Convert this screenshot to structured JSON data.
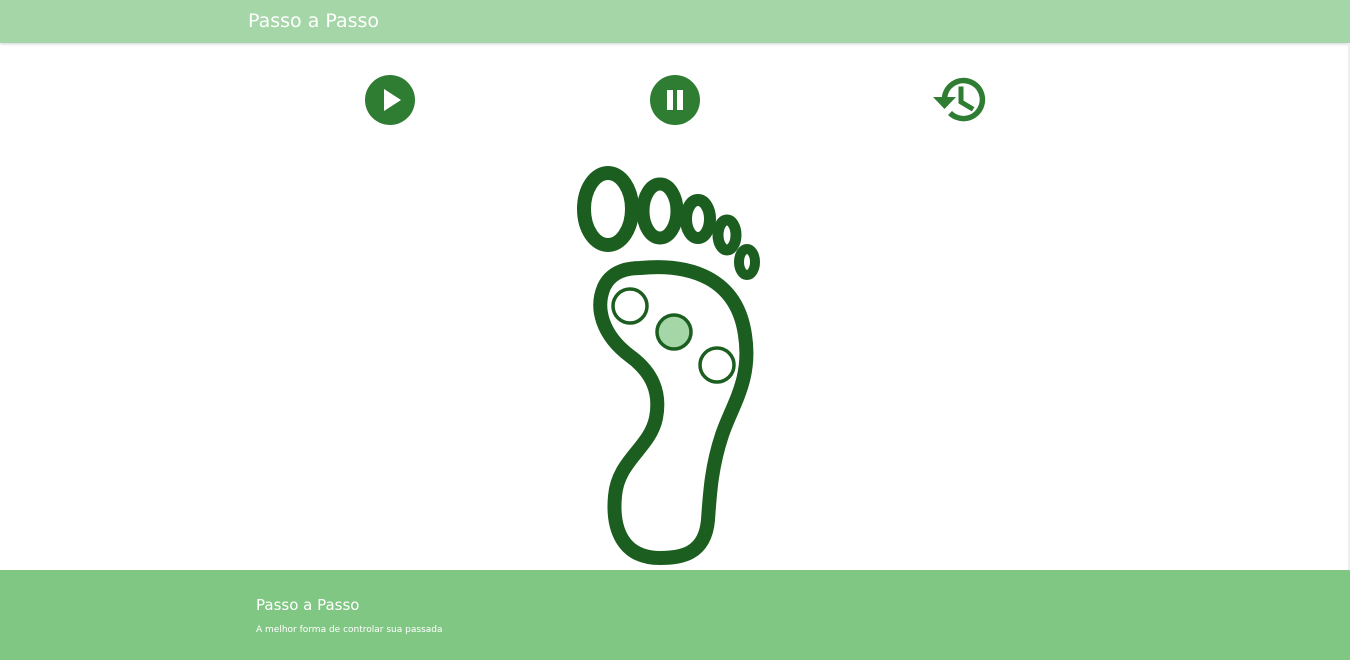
{
  "header": {
    "brand": "Passo a Passo"
  },
  "controls": {
    "play_icon": "play-icon",
    "pause_icon": "pause-icon",
    "history_icon": "history-icon"
  },
  "foot": {
    "sensors": [
      {
        "id": "sensor-1",
        "active": false
      },
      {
        "id": "sensor-2",
        "active": true
      },
      {
        "id": "sensor-3",
        "active": false
      }
    ]
  },
  "footer": {
    "title": "Passo a Passo",
    "subtitle": "A melhor forma de controlar sua passada"
  },
  "colors": {
    "header_bg": "#a5d6a7",
    "footer_bg": "#81c784",
    "button_green": "#2e7d32",
    "foot_outline": "#1b5e20",
    "sensor_active": "#a5d6a7"
  }
}
